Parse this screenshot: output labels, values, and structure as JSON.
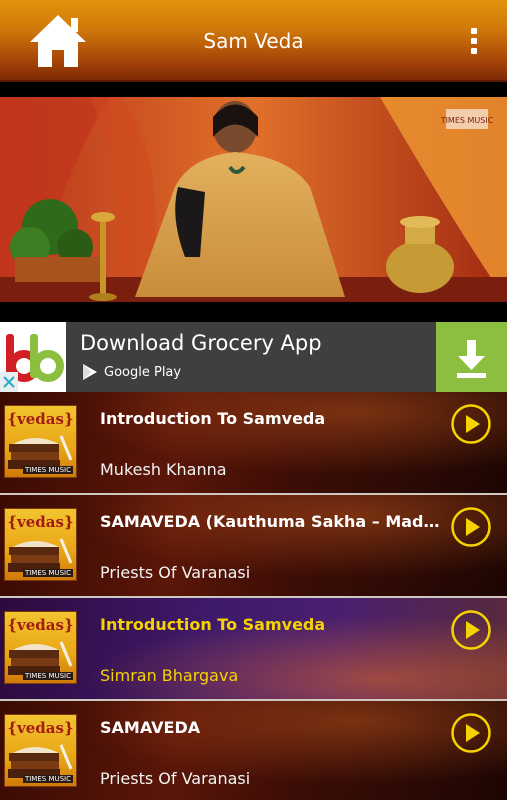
{
  "app_bar": {
    "title": "Sam Veda",
    "home_icon": "home-icon",
    "menu_icon": "more-vert-icon"
  },
  "video": {
    "channel_logo": "TIMES MUSIC"
  },
  "ad": {
    "headline": "Download Grocery App",
    "store_label": "Google Play",
    "accent": "#8cbf3f"
  },
  "tracks": [
    {
      "title": "Introduction To Samveda",
      "artist": "Mukesh Khanna",
      "active": false
    },
    {
      "title": "SAMAVEDA (Kauthuma Sakha – Madra Pa…",
      "artist": "Priests Of Varanasi",
      "active": false
    },
    {
      "title": "Introduction To Samveda",
      "artist": "Simran Bhargava",
      "active": true
    },
    {
      "title": "SAMAVEDA",
      "artist": "Priests Of Varanasi",
      "active": false
    }
  ],
  "thumb": {
    "logo": "{vedas}",
    "brand": "TIMES MUSIC"
  },
  "colors": {
    "highlight": "#f5d300",
    "play_ring": "#f5d300"
  }
}
